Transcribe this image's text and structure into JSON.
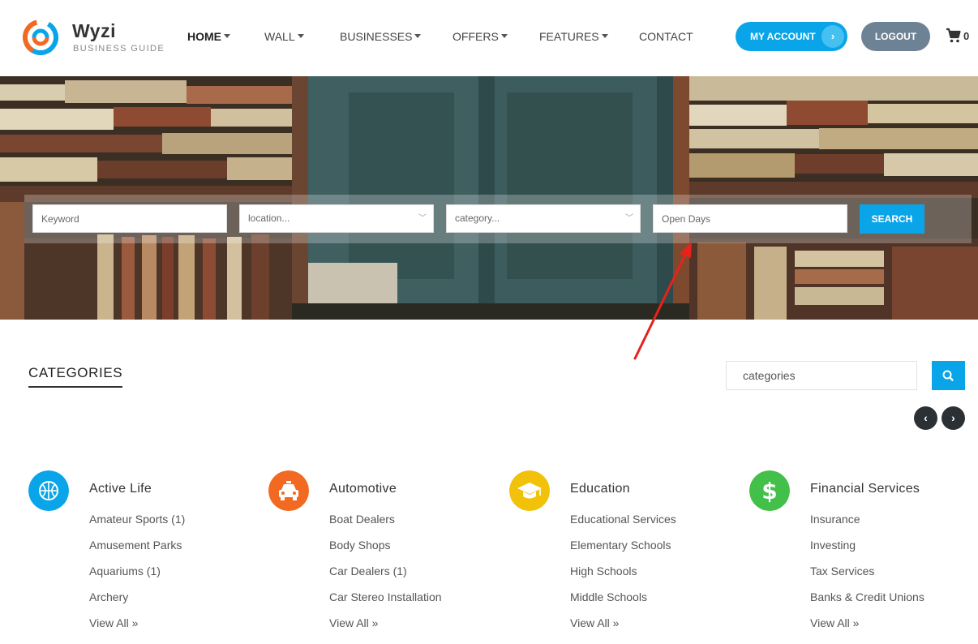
{
  "brand": {
    "name": "Wyzi",
    "tagline": "BUSINESS GUIDE"
  },
  "nav": [
    {
      "label": "HOME",
      "dropdown": true,
      "active": true
    },
    {
      "label": "WALL",
      "dropdown": true
    },
    {
      "label": "BUSINESSES",
      "dropdown": true
    },
    {
      "label": "OFFERS",
      "dropdown": true
    },
    {
      "label": "FEATURES",
      "dropdown": true
    },
    {
      "label": "CONTACT",
      "dropdown": false
    }
  ],
  "header": {
    "account_label": "MY ACCOUNT",
    "logout_label": "LOGOUT",
    "cart_count": "0"
  },
  "search": {
    "keyword_placeholder": "Keyword",
    "location_placeholder": "location...",
    "category_placeholder": "category...",
    "open_days_placeholder": "Open Days",
    "button_label": "SEARCH"
  },
  "categories_section": {
    "title": "CATEGORIES",
    "search_placeholder": "categories"
  },
  "categories": [
    {
      "name": "Active Life",
      "icon": "basketball-icon",
      "color": "#0aa5e8",
      "items": [
        "Amateur Sports (1)",
        "Amusement Parks",
        "Aquariums (1)",
        "Archery"
      ],
      "view_all": "View All »"
    },
    {
      "name": "Automotive",
      "icon": "taxi-icon",
      "color": "#f26a21",
      "items": [
        "Boat Dealers",
        "Body Shops",
        "Car Dealers (1)",
        "Car Stereo Installation"
      ],
      "view_all": "View All »"
    },
    {
      "name": "Education",
      "icon": "graduation-cap-icon",
      "color": "#f2c10a",
      "items": [
        "Educational Services",
        "Elementary Schools",
        "High Schools",
        "Middle Schools"
      ],
      "view_all": "View All »"
    },
    {
      "name": "Financial Services",
      "icon": "dollar-icon",
      "color": "#43c04a",
      "items": [
        "Insurance",
        "Investing",
        "Tax Services",
        "Banks & Credit Unions"
      ],
      "view_all": "View All »"
    }
  ],
  "colors": {
    "accent": "#0aa5e8",
    "logout": "#6e8296",
    "annotation": "#e8221b"
  }
}
